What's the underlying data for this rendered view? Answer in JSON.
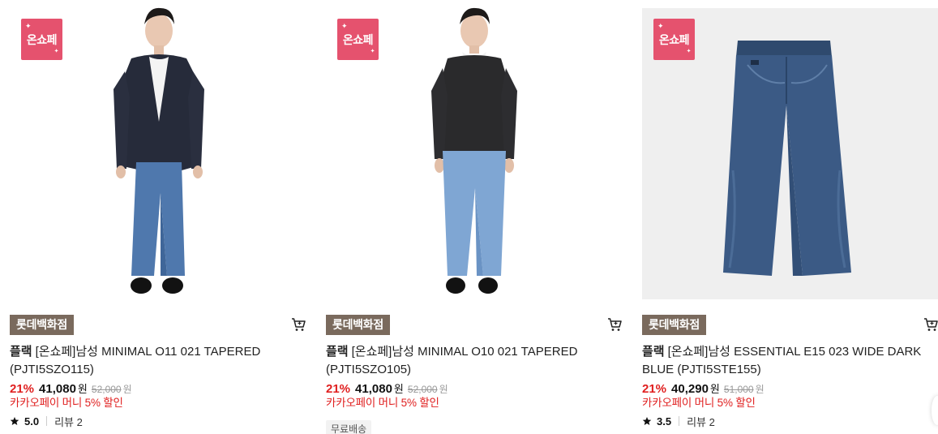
{
  "products": [
    {
      "onsale_badge": "온쇼페",
      "store": "롯데백화점",
      "brand": "플랙",
      "name": "[온쇼페]남성 MINIMAL O11 021 TAPERED (PJTI5SZO115)",
      "discount": "21%",
      "price": "41,080",
      "currency": "원",
      "original_price": "52,000",
      "original_currency": "원",
      "promo": "카카오페이 머니 5% 할인",
      "rating": "5.0",
      "review": "리뷰 2",
      "image_icon": "model-blazer-jeans"
    },
    {
      "onsale_badge": "온쇼페",
      "store": "롯데백화점",
      "brand": "플랙",
      "name": "[온쇼페]남성 MINIMAL O10 021 TAPERED (PJTI5SZO105)",
      "discount": "21%",
      "price": "41,080",
      "currency": "원",
      "original_price": "52,000",
      "original_currency": "원",
      "promo": "카카오페이 머니 5% 할인",
      "shipping": "무료배송",
      "image_icon": "model-sweater-jeans"
    },
    {
      "onsale_badge": "온쇼페",
      "store": "롯데백화점",
      "brand": "플랙",
      "name": "[온쇼페]남성 ESSENTIAL E15 023 WIDE DARK BLUE (PJTI5STE155)",
      "discount": "21%",
      "price": "40,290",
      "currency": "원",
      "original_price": "51,000",
      "original_currency": "원",
      "promo": "카카오페이 머니 5% 할인",
      "rating": "3.5",
      "review": "리뷰 2",
      "image_icon": "jeans-product"
    }
  ],
  "colors": {
    "onsale_badge": "#e5526e",
    "store_tag": "#7a6a5d",
    "discount": "#e02020",
    "promo": "#e02020"
  }
}
